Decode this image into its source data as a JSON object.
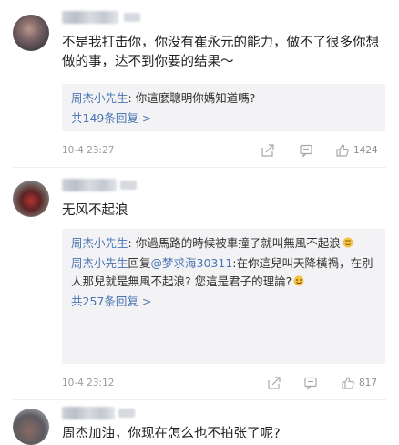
{
  "comments": [
    {
      "text": "不是我打击你，你没有崔永元的能力，做不了很多你想做的事，达不到你要的结果～",
      "replies": [
        {
          "name": "周杰小先生",
          "body": "你這麼聰明你媽知道嗎?"
        }
      ],
      "more": "共149条回复 >",
      "time": "10-4 23:27",
      "likes": "1424"
    },
    {
      "text": "无风不起浪",
      "replies": [
        {
          "name": "周杰小先生",
          "body": "你過馬路的時候被車撞了就叫無風不起浪"
        },
        {
          "name": "周杰小先生",
          "reply_word": "回复",
          "at": "@梦求海30311",
          "body": ":在你這兒叫天降橫禍，在別人那兒就是無風不起浪? 您這是君子的理論?"
        }
      ],
      "more": "共257条回复 >",
      "time": "10-4 23:12",
      "likes": "817"
    },
    {
      "text": "周杰加油，你现在怎么也不拍张了呢?"
    }
  ],
  "colors": {
    "link": "#4a76b2",
    "reply_bg": "#f3f3f5",
    "meta": "#9a9a9a"
  },
  "icons": [
    "share-icon",
    "comment-icon",
    "thumbs-up-icon",
    "emoji-icon"
  ]
}
